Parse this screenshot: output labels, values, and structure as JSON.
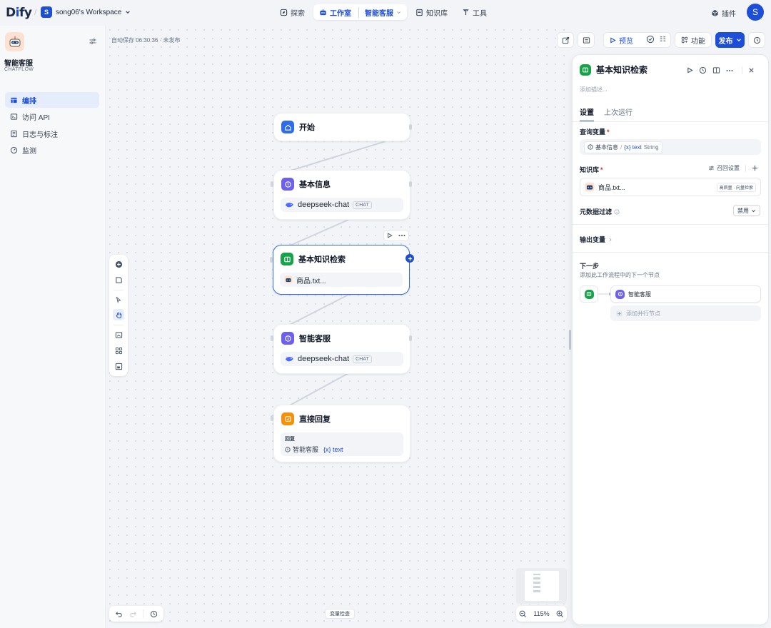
{
  "topbar": {
    "logo_prefix": "D",
    "logo_mid": "i",
    "logo_suffix": "fy",
    "workspace_initial": "S",
    "workspace_name": "song06's Workspace",
    "nav": {
      "explore": "探索",
      "studio": "工作室",
      "current_app": "智能客服",
      "knowledge": "知识库",
      "tools": "工具"
    },
    "plugins": "插件",
    "user_initial": "S"
  },
  "sidebar": {
    "app_name": "智能客服",
    "app_type": "CHATFLOW",
    "items": [
      {
        "label": "编排",
        "icon": "layout-icon",
        "active": true
      },
      {
        "label": "访问 API",
        "icon": "terminal-icon",
        "active": false
      },
      {
        "label": "日志与标注",
        "icon": "log-icon",
        "active": false
      },
      {
        "label": "监测",
        "icon": "monitor-icon",
        "active": false
      }
    ]
  },
  "canvas": {
    "autosave": "自动保存 06:30:36 · 未发布",
    "toolbar": {
      "preview": "预览",
      "features": "功能",
      "publish": "发布"
    },
    "nodes": {
      "start": {
        "title": "开始"
      },
      "basic_info": {
        "title": "基本信息",
        "model": "deepseek-chat",
        "badge": "CHAT"
      },
      "kb_retrieval": {
        "title": "基本知识检索",
        "file": "商品.txt..."
      },
      "customer_service": {
        "title": "智能客服",
        "model": "deepseek-chat",
        "badge": "CHAT"
      },
      "direct_reply": {
        "title": "直接回复",
        "label": "回复",
        "ref_node": "智能客服",
        "ref_var": "{x} text"
      }
    },
    "variable_check": "变量检查",
    "zoom": "115%"
  },
  "panel": {
    "title": "基本知识检索",
    "description_placeholder": "添加描述...",
    "tabs": {
      "settings": "设置",
      "last_run": "上次运行"
    },
    "query_variable": {
      "label": "查询变量",
      "node": "基本信息",
      "separator": "/",
      "var": "{x} text",
      "type": "String"
    },
    "knowledge": {
      "label": "知识库",
      "recall_settings": "召回设置",
      "item_name": "商品.txt...",
      "item_tag": "高质量 · 向量检索"
    },
    "metadata_filter": {
      "label": "元数据过滤",
      "value": "禁用"
    },
    "output_vars": {
      "label": "输出变量"
    },
    "next_step": {
      "title": "下一步",
      "subtitle": "添加此工作流程中的下一个节点",
      "node": "智能客服",
      "add_parallel": "添加并行节点"
    }
  },
  "colors": {
    "primary": "#1d4ed8",
    "node_blue": "#2f6bed",
    "node_purple": "#6d5ff0",
    "node_green": "#16a34a",
    "node_orange": "#f79009"
  }
}
